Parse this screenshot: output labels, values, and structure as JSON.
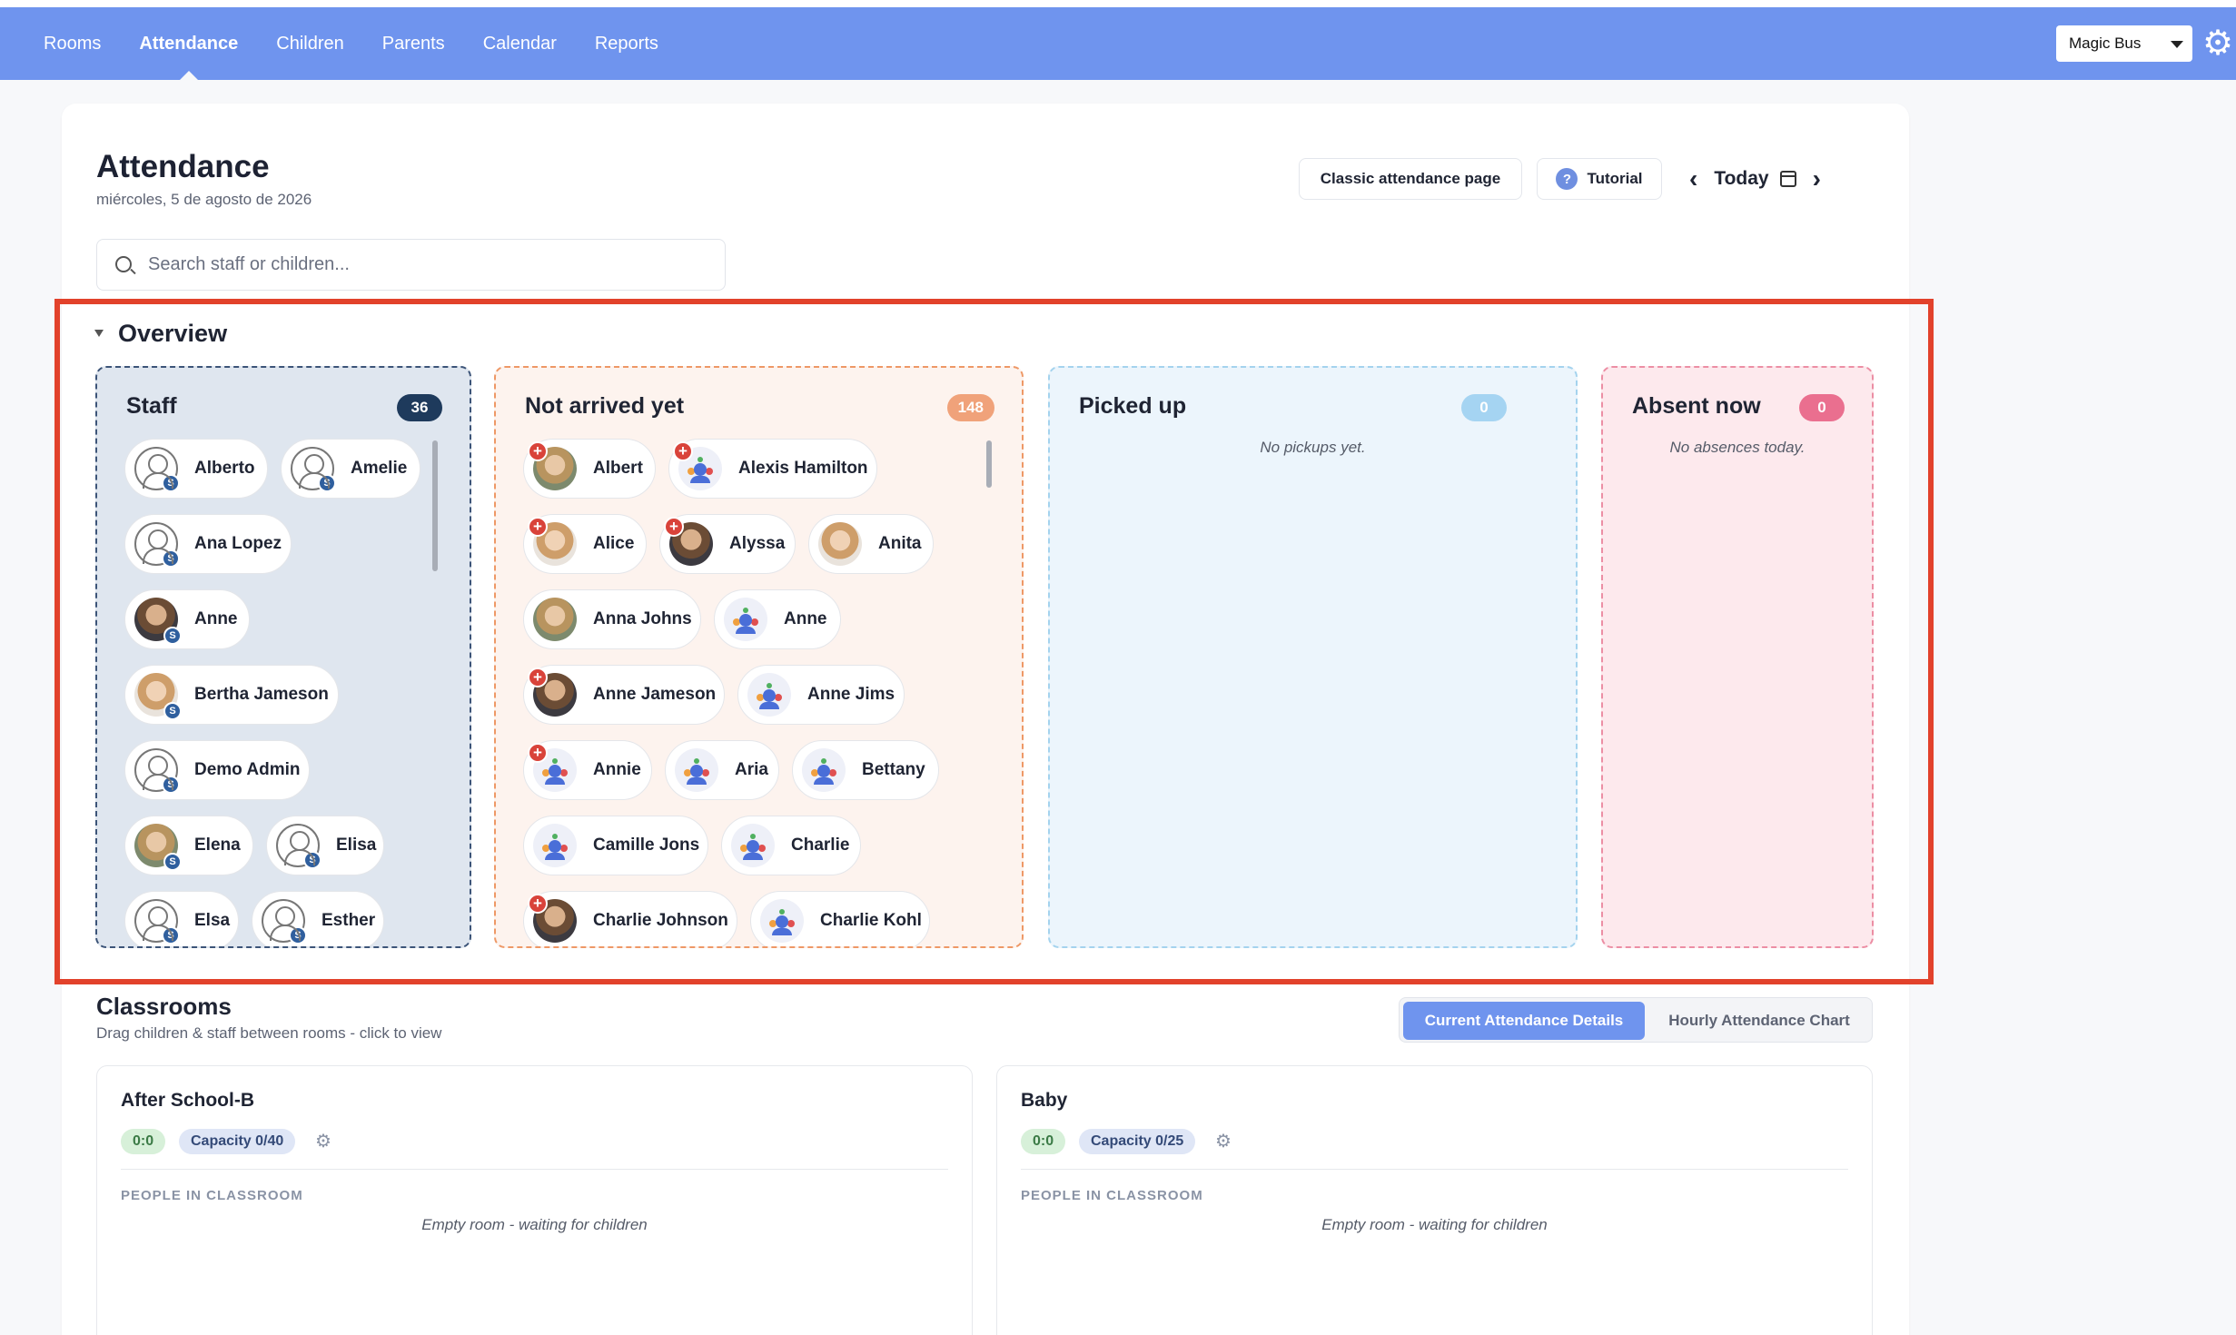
{
  "nav": {
    "items": [
      "Rooms",
      "Attendance",
      "Children",
      "Parents",
      "Calendar",
      "Reports"
    ],
    "active": "Attendance",
    "org_select": "Magic Bus"
  },
  "header": {
    "title": "Attendance",
    "date": "miércoles, 5 de agosto de 2026",
    "classic_button": "Classic attendance page",
    "tutorial_button": "Tutorial",
    "tutorial_icon": "?",
    "today_label": "Today"
  },
  "search": {
    "placeholder": "Search staff or children..."
  },
  "overview": {
    "title": "Overview",
    "staff": {
      "title": "Staff",
      "count": "36",
      "badge_letter": "S",
      "people": [
        "Alberto",
        "Amelie",
        "Ana Lopez",
        "Anne",
        "Bertha Jameson",
        "Demo Admin",
        "Elena",
        "Elisa",
        "Elsa",
        "Esther"
      ]
    },
    "not_arrived": {
      "title": "Not arrived yet",
      "count": "148",
      "plus_sign": "+",
      "children": [
        "Albert",
        "Alexis Hamilton",
        "Alice",
        "Alyssa",
        "Anita",
        "Anna Johns",
        "Anne",
        "Anne Jameson",
        "Anne Jims",
        "Annie",
        "Aria",
        "Bettany",
        "Camille Jons",
        "Charlie",
        "Charlie Johnson",
        "Charlie Kohl"
      ]
    },
    "picked_up": {
      "title": "Picked up",
      "count": "0",
      "empty": "No pickups yet."
    },
    "absent": {
      "title": "Absent now",
      "count": "0",
      "empty": "No absences today."
    }
  },
  "classrooms": {
    "title": "Classrooms",
    "subtitle": "Drag children & staff between rooms - click to view",
    "toggle_current": "Current Attendance Details",
    "toggle_hourly": "Hourly Attendance Chart",
    "people_label": "PEOPLE IN CLASSROOM",
    "rooms": [
      {
        "name": "After School-B",
        "ratio": "0:0",
        "capacity": "Capacity 0/40",
        "empty": "Empty room - waiting for children"
      },
      {
        "name": "Baby",
        "ratio": "0:0",
        "capacity": "Capacity 0/25",
        "empty": "Empty room - waiting for children"
      }
    ]
  },
  "colors": {
    "topbar": "#6f94ee",
    "highlight": "#e2422b",
    "staff_badge": "#1e3a5c",
    "not_arrived_badge": "#f0a27a",
    "picked_badge": "#a5d4f2",
    "absent_badge": "#ea6f8f"
  },
  "icons": [
    "gear-icon",
    "search-icon",
    "calendar-icon",
    "chevron-left-icon",
    "chevron-right-icon",
    "help-icon",
    "caret-down-icon"
  ]
}
